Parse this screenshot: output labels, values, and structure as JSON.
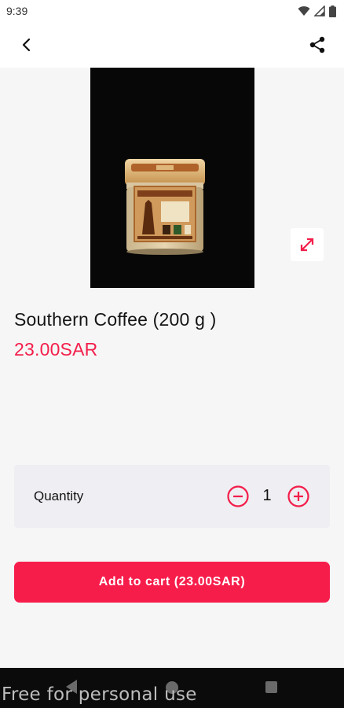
{
  "status_bar": {
    "time": "9:39",
    "icons": [
      "wifi-icon",
      "signal-icon",
      "battery-icon"
    ]
  },
  "app_bar": {
    "back_icon": "chevron-left-icon",
    "share_icon": "share-icon"
  },
  "product": {
    "name": "Southern Coffee (200 g )",
    "price": "23.00SAR",
    "image_description_icon": "coffee-jar-image",
    "expand_icon": "expand-icon"
  },
  "quantity": {
    "label": "Quantity",
    "value": "1",
    "decrease_icon": "minus-circle-icon",
    "increase_icon": "plus-circle-icon"
  },
  "cart": {
    "button_label": "Add to cart (23.00SAR)"
  },
  "watermark": "Free for personal use",
  "colors": {
    "accent": "#f71d4b",
    "price": "#f31e4a",
    "background": "#f6f6f6",
    "quantity_box": "#efeef2"
  }
}
